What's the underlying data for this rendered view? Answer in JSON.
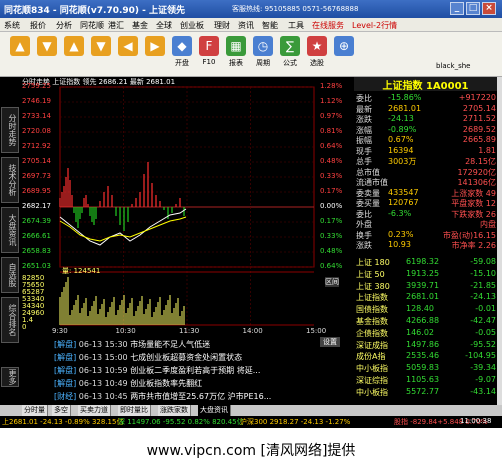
{
  "app": {
    "title": "同花顺834 - 同花顺(v7.70.90) - 上证领先",
    "hotline": "客服热线: 95105885 0571-56768888"
  },
  "menu": [
    "系统",
    "报价",
    "分析",
    "同花顺",
    "港汇",
    "基金",
    "全球",
    "创业板",
    "理财",
    "资讯",
    "智能",
    "工具",
    "在线服务",
    "Level-2行情"
  ],
  "toolbar": [
    {
      "label": "",
      "icon": "▲",
      "color": "#e8a020"
    },
    {
      "label": "",
      "icon": "▼",
      "color": "#e8a020"
    },
    {
      "label": "",
      "icon": "▲",
      "color": "#e8a020"
    },
    {
      "label": "",
      "icon": "▼",
      "color": "#e8a020"
    },
    {
      "label": "",
      "icon": "◀",
      "color": "#e8a020"
    },
    {
      "label": "",
      "icon": "▶",
      "color": "#e8a020"
    },
    {
      "label": "开盘",
      "icon": "◆",
      "color": "#4a7fd1"
    },
    {
      "label": "F10",
      "icon": "F",
      "color": "#d04040"
    },
    {
      "label": "报表",
      "icon": "▦",
      "color": "#3a9a3a"
    },
    {
      "label": "周期",
      "icon": "◷",
      "color": "#4a7fd1"
    },
    {
      "label": "公式",
      "icon": "∑",
      "color": "#3a9a3a"
    },
    {
      "label": "选股",
      "icon": "★",
      "color": "#d04040"
    },
    {
      "label": "",
      "icon": "⊕",
      "color": "#4a7fd1"
    }
  ],
  "user": "black_she",
  "window_buttons": [
    "_",
    "□",
    "×"
  ],
  "left_tabs": [
    "分时走势",
    "技术分析",
    "大盘资讯",
    "自选股",
    "综合排名",
    "更多"
  ],
  "chart": {
    "header": "分时走势 上证指数 领先 2686.21 最新 2681.01",
    "price_ticks": [
      "2759.25",
      "2746.19",
      "2733.14",
      "2720.08",
      "2712.92",
      "2705.14",
      "2697.73",
      "2689.95",
      "2682.17",
      "2674.39",
      "2666.61",
      "2658.83",
      "2651.03"
    ],
    "pct_ticks": [
      "1.28%",
      "1.12%",
      "0.97%",
      "0.81%",
      "0.64%",
      "0.48%",
      "0.33%",
      "0.17%",
      "0.00%",
      "0.17%",
      "0.33%",
      "0.48%",
      "0.64%"
    ],
    "vol_label": "量: 124541",
    "vol_ticks": [
      "82850",
      "75650",
      "65287",
      "53340",
      "34340",
      "24960",
      "1.4",
      "0"
    ],
    "time_ticks": [
      "9:30",
      "10:30",
      "11:30",
      "14:00",
      "15:00"
    ],
    "tab": "区间"
  },
  "side": {
    "title": "上证指数 1A0001",
    "rows": [
      [
        "委比",
        "-15.86%",
        "+917220"
      ],
      [
        "最新",
        "2681.01",
        "2705.14"
      ],
      [
        "涨跌",
        "-24.13",
        "2711.52"
      ],
      [
        "涨幅",
        "-0.89%",
        "2689.52"
      ],
      [
        "振幅",
        "0.67%",
        "2665.89"
      ],
      [
        "现手",
        "16394",
        "1.81"
      ],
      [
        "总手",
        "3003万",
        "28.15亿"
      ],
      [
        "总市值",
        "",
        "172920亿"
      ],
      [
        "流通市值",
        "",
        "141306亿"
      ],
      [
        "委卖量",
        "433547",
        "上涨家数 49"
      ],
      [
        "委买量",
        "120767",
        "平盘家数 12"
      ],
      [
        "委比",
        "-6.3%",
        "下跌家数 26"
      ],
      [
        "外盘",
        "",
        "内盘"
      ],
      [
        "换手",
        "0.23%",
        "市盈(动)16.15"
      ],
      [
        "涨跌",
        "10.93",
        "市净率 2.26"
      ]
    ],
    "indices": [
      [
        "上证 180",
        "6198.32",
        "-59.08"
      ],
      [
        "上证 50",
        "1913.25",
        "-15.10"
      ],
      [
        "上证 380",
        "3939.71",
        "-21.85"
      ],
      [
        "上证指数",
        "2681.01",
        "-24.13"
      ],
      [
        "国债指数",
        "128.40",
        "-0.01"
      ],
      [
        "基金指数",
        "4266.88",
        "-42.47"
      ],
      [
        "企债指数",
        "146.02",
        "-0.05"
      ],
      [
        "深证成指",
        "1497.86",
        "-95.52"
      ],
      [
        "成份A指",
        "2535.46",
        "-104.95"
      ],
      [
        "中小板指",
        "5059.83",
        "-39.34"
      ],
      [
        "深证综指",
        "1105.63",
        "-9.07"
      ],
      [
        "中小板指",
        "5572.77",
        "-43.14"
      ]
    ]
  },
  "news": {
    "header": "设置",
    "items": [
      {
        "tag": "[解盘]",
        "time": "06-13 15:30",
        "text": "市场量能不足人气低迷"
      },
      {
        "tag": "[解盘]",
        "time": "06-13 15:00",
        "text": "七成创业板超募资金处闲置状态"
      },
      {
        "tag": "[解盘]",
        "time": "06-13 10:59",
        "text": "创业板二季度盈利若高于预期 将延..."
      },
      {
        "tag": "[解盘]",
        "time": "06-13 10:49",
        "text": "创业板指数率先翻红"
      },
      {
        "tag": "[财经]",
        "time": "06-13 10:45",
        "text": "两市共市值增至25.67万亿 沪市PE16..."
      }
    ]
  },
  "bottom_tabs": [
    "分时量",
    "多空",
    "买卖力道",
    "即时量比",
    "涨跌家数",
    "大盘资讯"
  ],
  "ticker": {
    "left": "上2681.01 -24.13 -0.89% 328.15亿",
    "mid": "深 11497.06 -95.52 0.82% 820.45亿",
    "right": "沪深300 2918.27 -24.13 -1.27%",
    "tail": "股指  -829.84+5.848  0.70%",
    "clock": "11:00:38"
  },
  "watermark": "www.vipcn.com [清风网络]提供"
}
